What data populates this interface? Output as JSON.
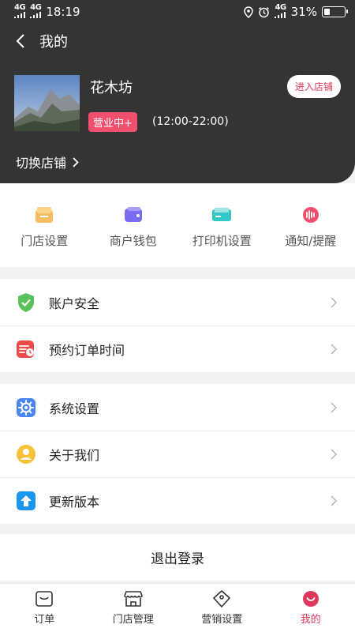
{
  "status_bar": {
    "signal1": "4G",
    "signal2": "4G",
    "time": "18:19",
    "network": "4G",
    "battery": "31%",
    "battery_level": 0.31
  },
  "header": {
    "title": "我的",
    "shop_name": "花木坊",
    "status_badge": "营业中+",
    "hours": "(12:00-22:00)",
    "enter_store": "进入店铺",
    "switch_store": "切换店铺"
  },
  "quick_actions": [
    {
      "label": "门店设置",
      "icon": "store-settings-icon",
      "color": "#f6b24a"
    },
    {
      "label": "商户钱包",
      "icon": "wallet-icon",
      "color": "#7a6cf0"
    },
    {
      "label": "打印机设置",
      "icon": "printer-icon",
      "color": "#34c7c7"
    },
    {
      "label": "通知/提醒",
      "icon": "notification-icon",
      "color": "#f0506e"
    }
  ],
  "menu_group1": [
    {
      "label": "账户安全",
      "icon": "shield-check-icon",
      "color": "#57c15a"
    },
    {
      "label": "预约订单时间",
      "icon": "schedule-order-icon",
      "color": "#ef4a4a"
    }
  ],
  "menu_group2": [
    {
      "label": "系统设置",
      "icon": "gear-icon",
      "color": "#4a86f0"
    },
    {
      "label": "关于我们",
      "icon": "user-circle-icon",
      "color": "#f6c23a"
    },
    {
      "label": "更新版本",
      "icon": "upload-arrow-icon",
      "color": "#1a95f0"
    }
  ],
  "logout": "退出登录",
  "tabs": [
    {
      "label": "订单",
      "icon": "order-icon",
      "active": false
    },
    {
      "label": "门店管理",
      "icon": "store-icon",
      "active": false
    },
    {
      "label": "营销设置",
      "icon": "tag-icon",
      "active": false
    },
    {
      "label": "我的",
      "icon": "profile-icon",
      "active": true
    }
  ],
  "colors": {
    "header_bg": "#353434",
    "accent": "#e0385c",
    "badge": "#f0506e",
    "page_bg": "#f2f1f4"
  }
}
